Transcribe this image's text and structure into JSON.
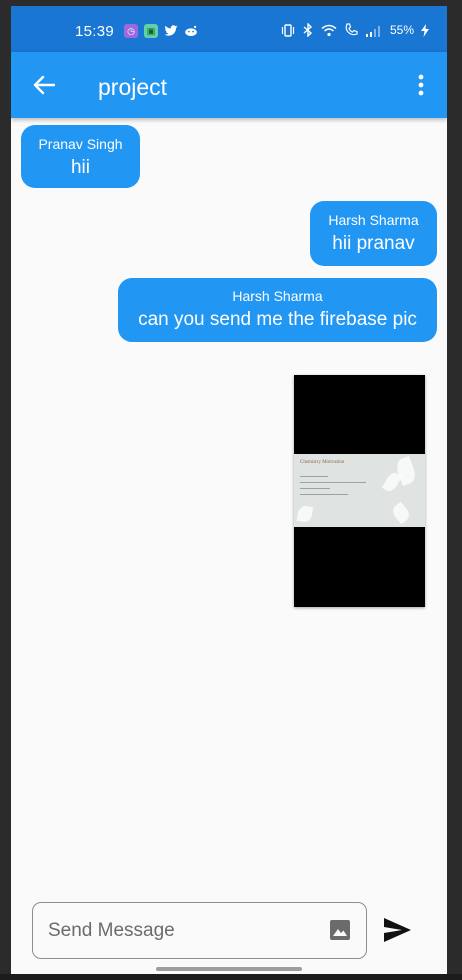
{
  "status_bar": {
    "time": "15:39",
    "battery": "55%",
    "notification_icons": [
      "alarm-icon",
      "app-icon",
      "twitter-icon",
      "reddit-icon"
    ]
  },
  "app_bar": {
    "title": "project"
  },
  "messages": [
    {
      "sender": "Pranav Singh",
      "text": "hii",
      "side": "left"
    },
    {
      "sender": "Harsh Sharma",
      "text": "hii pranav",
      "side": "right"
    },
    {
      "sender": "Harsh Sharma",
      "text": "can you send me the firebase pic",
      "side": "right"
    }
  ],
  "image_message": {
    "side": "right",
    "slide_title": "Chemistry Motivation"
  },
  "composer": {
    "placeholder": "Send Message",
    "value": ""
  },
  "colors": {
    "status_bar": "#1976d2",
    "app_bar": "#2196f3",
    "bubble": "#2196f3",
    "background": "#fafafa"
  }
}
